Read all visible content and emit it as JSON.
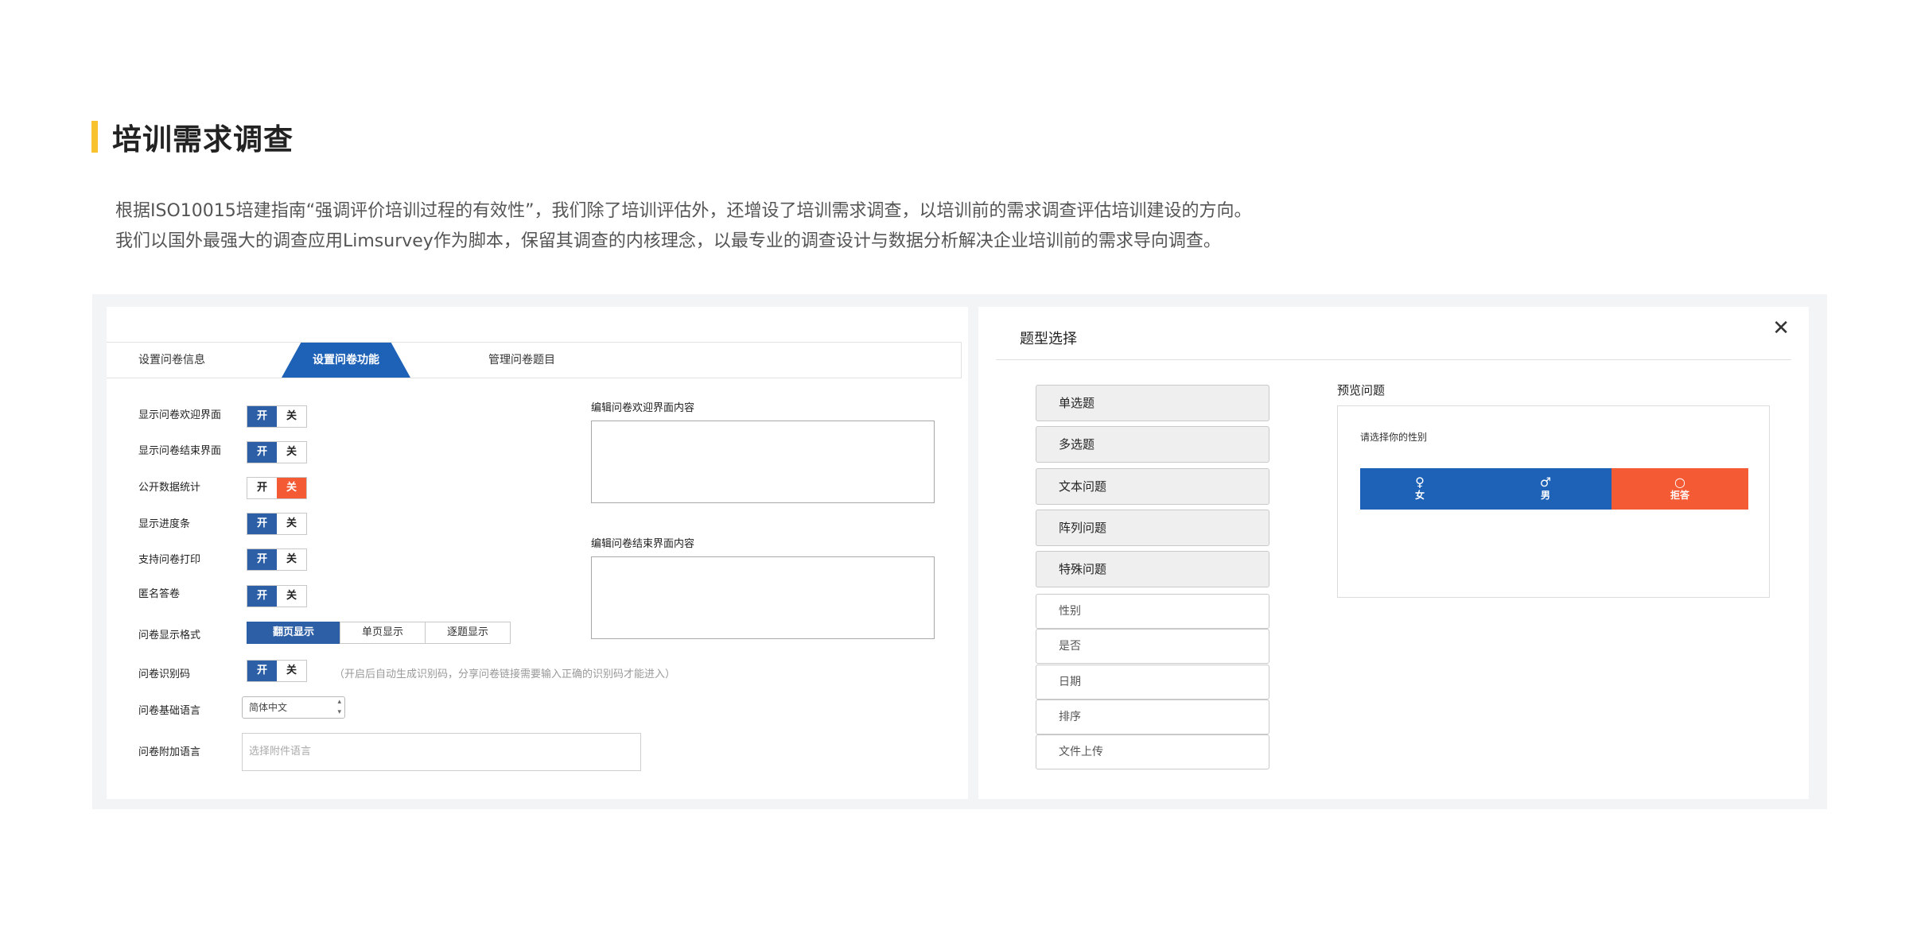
{
  "section": {
    "title": "培训需求调查",
    "desc_line1": "根据ISO10015培建指南“强调评价培训过程的有效性”，我们除了培训评估外，还增设了培训需求调查，以培训前的需求调查评估培训建设的方向。",
    "desc_line2": "我们以国外最强大的调查应用Limsurvey作为脚本，保留其调查的内核理念，以最专业的调查设计与数据分析解决企业培训前的需求导向调查。",
    "accent_color": "#f7c22e"
  },
  "settings_panel": {
    "tabs": [
      {
        "label": "设置问卷信息",
        "active": false
      },
      {
        "label": "设置问卷功能",
        "active": true
      },
      {
        "label": "管理问卷题目",
        "active": false
      }
    ],
    "rows": [
      {
        "label": "显示问卷欢迎界面",
        "on": "开",
        "off": "关",
        "state": "on"
      },
      {
        "label": "显示问卷结束界面",
        "on": "开",
        "off": "关",
        "state": "on"
      },
      {
        "label": "公开数据统计",
        "on": "开",
        "off": "关",
        "state": "off"
      },
      {
        "label": "显示进度条",
        "on": "开",
        "off": "关",
        "state": "on"
      },
      {
        "label": "支持问卷打印",
        "on": "开",
        "off": "关",
        "state": "on"
      },
      {
        "label": "匿名答卷",
        "on": "开",
        "off": "关",
        "state": "on"
      }
    ],
    "format": {
      "label": "问卷显示格式",
      "options": [
        "翻页显示",
        "单页显示",
        "逐题显示"
      ],
      "selected": "翻页显示"
    },
    "code": {
      "label": "问卷识别码",
      "on": "开",
      "off": "关",
      "state": "on",
      "hint": "（开启后自动生成识别码，分享问卷链接需要输入正确的识别码才能进入）"
    },
    "language": {
      "label": "问卷基础语言",
      "value": "简体中文"
    },
    "extra_language": {
      "label": "问卷附加语言",
      "placeholder": "选择附件语言"
    },
    "welcome_editor_label": "编辑问卷欢迎界面内容",
    "end_editor_label": "编辑问卷结束界面内容",
    "colors": {
      "on": "#2d5fa6",
      "off_active": "#f45a34",
      "tab_active": "#1e62b8"
    }
  },
  "type_modal": {
    "title": "题型选择",
    "close_icon": "close-icon",
    "categories": [
      "单选题",
      "多选题",
      "文本问题",
      "阵列问题",
      "特殊问题"
    ],
    "special_items": [
      "性别",
      "是否",
      "日期",
      "排序",
      "文件上传"
    ],
    "preview": {
      "label": "预览问题",
      "question": "请选择你的性别",
      "options": [
        {
          "symbol": "♀",
          "label": "女",
          "color": "#1e62b8"
        },
        {
          "symbol": "♂",
          "label": "男",
          "color": "#1e62b8"
        },
        {
          "symbol": "○",
          "label": "拒答",
          "color": "#f45a34"
        }
      ]
    }
  }
}
